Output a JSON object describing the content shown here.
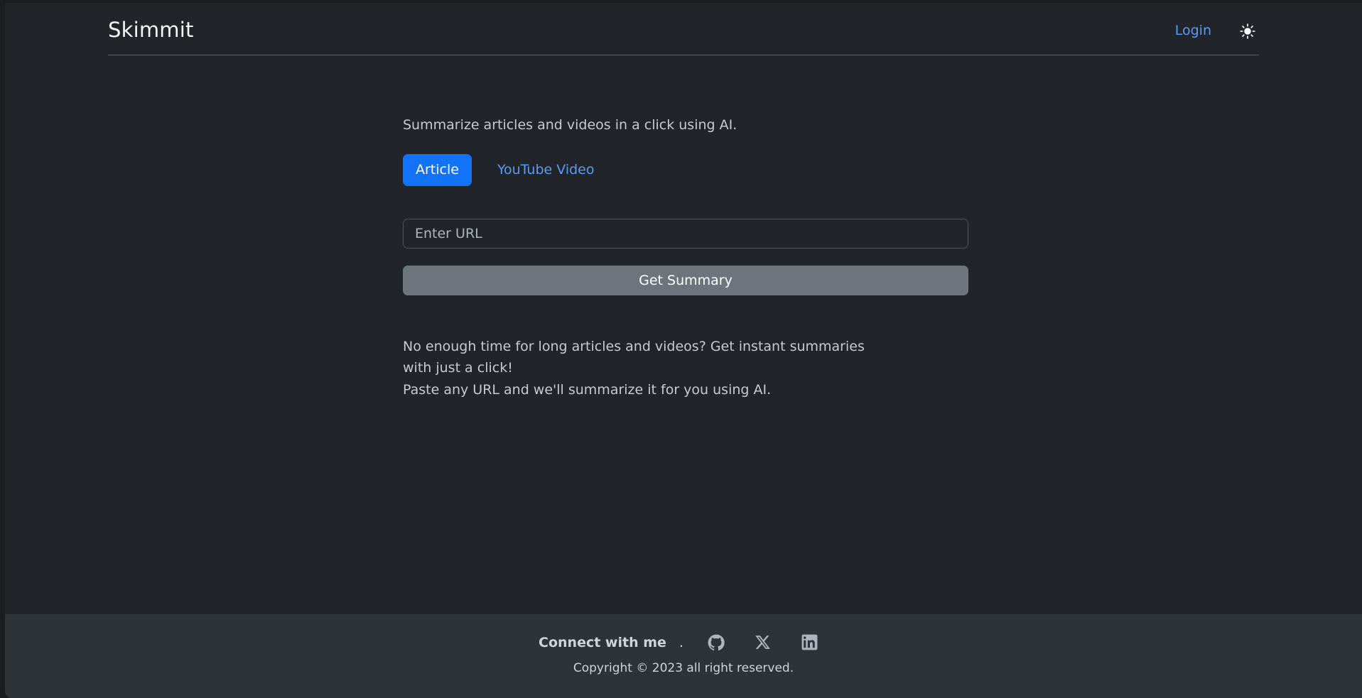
{
  "brand": {
    "name": "Skimmit"
  },
  "header": {
    "login_label": "Login",
    "theme_toggle_icon": "sun-icon"
  },
  "main": {
    "tagline": "Summarize articles and videos in a click using AI.",
    "tabs": [
      {
        "label": "Article",
        "active": true
      },
      {
        "label": "YouTube Video",
        "active": false
      }
    ],
    "url_input": {
      "placeholder": "Enter URL",
      "value": ""
    },
    "submit_label": "Get Summary",
    "description_line1": "No enough time for long articles and videos? Get instant summaries with just a click!",
    "description_line2": "Paste any URL and we'll summarize it for you using AI."
  },
  "footer": {
    "connect_label": "Connect with me",
    "separator": ".",
    "socials": [
      {
        "name": "github",
        "icon": "github-icon"
      },
      {
        "name": "x-twitter",
        "icon": "x-icon"
      },
      {
        "name": "linkedin",
        "icon": "linkedin-icon"
      }
    ],
    "copyright": "Copyright © 2023 all right reserved."
  },
  "colors": {
    "page_background": "#212529",
    "footer_background": "#2e3338",
    "accent_blue": "#1272fa",
    "link_blue": "#5b9bf8",
    "muted_button": "#6c757d",
    "body_text": "#c5cbd1"
  }
}
